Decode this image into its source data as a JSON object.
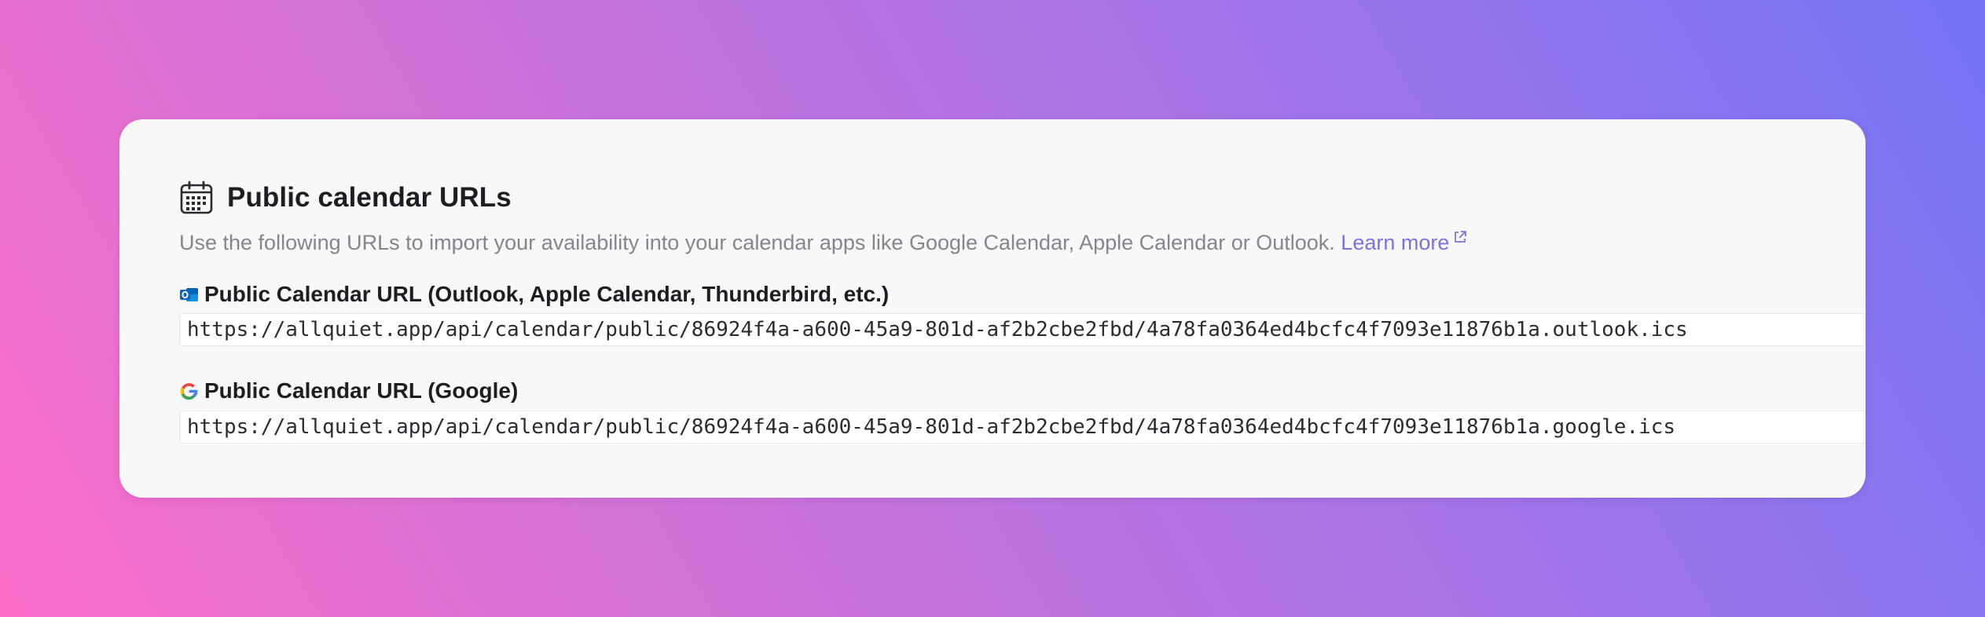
{
  "header": {
    "icon": "calendar-icon",
    "title": "Public calendar URLs"
  },
  "description": {
    "text": "Use the following URLs to import your availability into your calendar apps like Google Calendar, Apple Calendar or Outlook. ",
    "link_label": "Learn more",
    "link_icon": "external-link-icon"
  },
  "outlook": {
    "icon": "outlook-icon",
    "label": "Public Calendar URL (Outlook, Apple Calendar, Thunderbird, etc.)",
    "url": "https://allquiet.app/api/calendar/public/86924f4a-a600-45a9-801d-af2b2cbe2fbd/4a78fa0364ed4bcfc4f7093e11876b1a.outlook.ics"
  },
  "google": {
    "icon": "google-icon",
    "label": "Public Calendar URL (Google)",
    "url": "https://allquiet.app/api/calendar/public/86924f4a-a600-45a9-801d-af2b2cbe2fbd/4a78fa0364ed4bcfc4f7093e11876b1a.google.ics"
  },
  "colors": {
    "background_gradient": [
      "#fb6ec8",
      "#a874e6",
      "#7474f4"
    ],
    "card": "#f8f8f8",
    "link": "#7f70dc",
    "muted_text": "#85858f",
    "outlook_blue": "#0a64c8"
  }
}
